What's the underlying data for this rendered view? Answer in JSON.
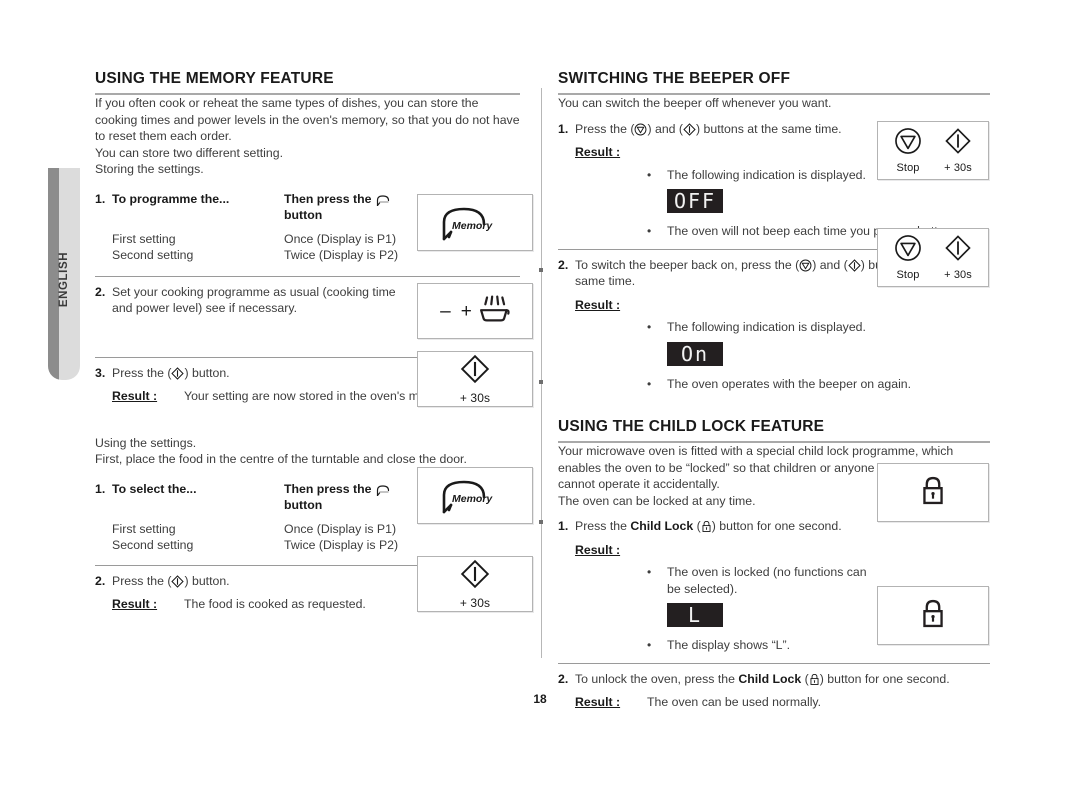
{
  "page": {
    "number": "18",
    "language_tab": "ENGLISH"
  },
  "left_column": {
    "section_title": "Using the memory feature",
    "intro": "If you often cook or reheat the same types of dishes, you can store the cooking times and power levels in the oven's memory, so that you do not have to reset them each order.",
    "intro2": "You can store two different setting.",
    "storing_heading": "Storing the settings.",
    "step1": {
      "num": "1.",
      "col1_header": "To programme the...",
      "col2_header_pre": "Then press the",
      "col2_header_post": "button",
      "rows": [
        {
          "action": "First setting",
          "press": "Once (Display is P1)"
        },
        {
          "action": "Second setting",
          "press": "Twice (Display is P2)"
        }
      ],
      "icon_box": {
        "label": "Memory",
        "icon": "memory-head-icon"
      }
    },
    "step2": {
      "num": "2.",
      "text": "Set your cooking programme as usual (cooking time and power level) see if necessary.",
      "icon_box": {
        "minus": "–",
        "plus": "+",
        "icon": "cooking-dish-icon"
      }
    },
    "step3": {
      "num": "3.",
      "text_pre": "Press the (",
      "text_post": ") button.",
      "result_label": "Result :",
      "result_text": "Your setting are now stored in the oven's memory.",
      "icon_box": {
        "caption": "+ 30s",
        "icon": "start-diamond-icon"
      }
    },
    "using_heading": "Using the settings.",
    "using_intro": "First, place the food in the centre of the turntable and close the door.",
    "step4": {
      "num": "1.",
      "col1_header": "To select the...",
      "col2_header_pre": "Then press the",
      "col2_header_post": "button",
      "rows": [
        {
          "action": "First setting",
          "press": "Once (Display is P1)"
        },
        {
          "action": "Second setting",
          "press": "Twice (Display is P2)"
        }
      ],
      "icon_box": {
        "label": "Memory",
        "icon": "memory-head-icon"
      }
    },
    "step5": {
      "num": "2.",
      "text_pre": "Press the (",
      "text_post": ") button.",
      "result_label": "Result :",
      "result_text": "The food is cooked as requested.",
      "icon_box": {
        "caption": "+ 30s",
        "icon": "start-diamond-icon"
      }
    }
  },
  "right_column": {
    "beeper": {
      "section_title": "Switching the beeper off",
      "intro": "You can switch the beeper off whenever you want.",
      "step1": {
        "num": "1.",
        "text_a": "Press the (",
        "text_b": ") and (",
        "text_c": ") buttons at the same time.",
        "result_label": "Result :",
        "bullet1": "The following indication is displayed.",
        "display": "OFF",
        "bullet2": "The  oven will not beep each time you press a button.",
        "icon_box": {
          "stop_caption": "Stop",
          "start_caption": "+ 30s"
        }
      },
      "step2": {
        "num": "2.",
        "text_a": "To switch the beeper back on, press the (",
        "text_b": ") and (",
        "text_c": ") buttons again at the same time.",
        "result_label": "Result :",
        "bullet1": "The following indication is displayed.",
        "display": "On",
        "bullet2": "The oven operates with the beeper on again.",
        "icon_box": {
          "stop_caption": "Stop",
          "start_caption": "+ 30s"
        }
      }
    },
    "childlock": {
      "section_title": "Using the child lock feature",
      "intro": "Your microwave oven is fitted with a special child lock programme, which enables the oven to be “locked” so that children or anyone unfamiliar with it cannot operate it accidentally.",
      "intro2": "The oven can be locked at any time.",
      "step1": {
        "num": "1.",
        "text_a": "Press the ",
        "text_bold": "Child Lock",
        "text_b": " (",
        "text_c": ") button for one second.",
        "result_label": "Result :",
        "bullet1": "The oven is locked (no functions can be selected).",
        "display": "L",
        "bullet2": "The display shows “L”.",
        "icon_box": {
          "icon": "padlock-icon"
        }
      },
      "step2": {
        "num": "2.",
        "text_a": "To unlock the oven, press the ",
        "text_bold": "Child Lock",
        "text_b": " (",
        "text_c": ") button for one second.",
        "result_label": "Result :",
        "result_text": "The oven can be used normally.",
        "icon_box": {
          "icon": "padlock-icon"
        }
      }
    }
  },
  "colors": {
    "text": "#3d3d3d",
    "heading": "#1a1a1a",
    "rule": "#a9a9a9",
    "tab_strip": "#8c8c8c",
    "tab_body": "#dcdcdc",
    "lcd_bg": "#231f20",
    "lcd_fg": "#f2f2f2"
  }
}
